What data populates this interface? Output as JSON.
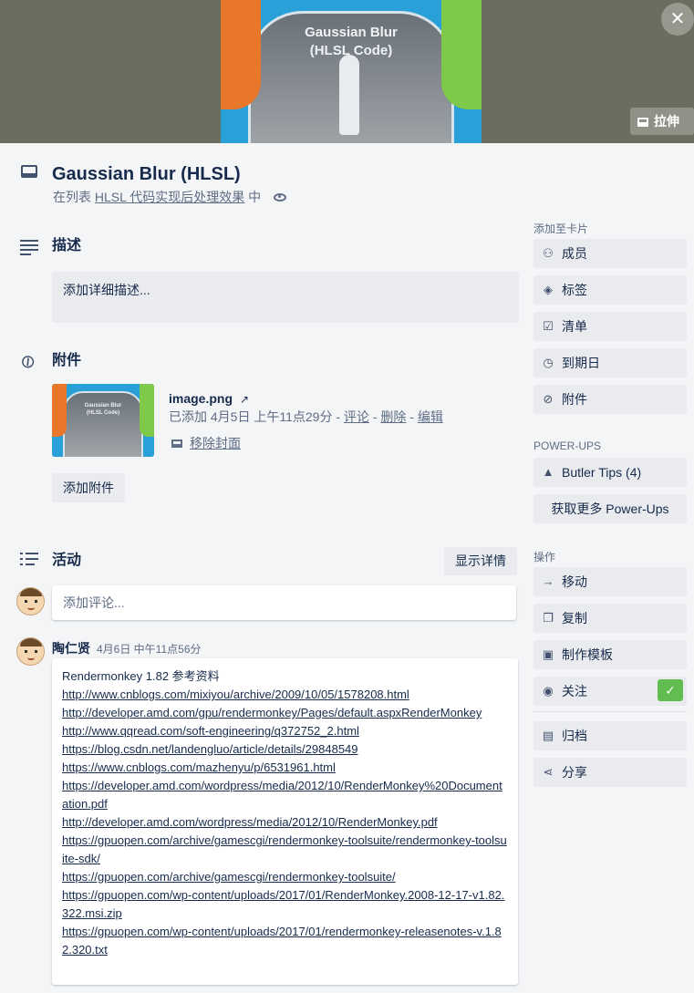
{
  "cover": {
    "image_text_line1": "Gaussian Blur",
    "image_text_line2": "(HLSL Code)",
    "stretch_label": "拉伸"
  },
  "card": {
    "title": "Gaussian Blur (HLSL)",
    "in_list_prefix": "在列表",
    "list_name": "HLSL 代码实现后处理效果",
    "in_list_suffix": "中"
  },
  "description": {
    "heading": "描述",
    "placeholder": "添加详细描述..."
  },
  "attachments": {
    "heading": "附件",
    "items": [
      {
        "name": "image.png",
        "added": "已添加 4月5日 上午11点29分",
        "comment": "评论",
        "delete": "删除",
        "edit": "编辑",
        "remove_cover": "移除封面",
        "sep": "-"
      }
    ],
    "add_label": "添加附件"
  },
  "activity": {
    "heading": "活动",
    "show_details": "显示详情",
    "comment_placeholder": "添加评论...",
    "comments": [
      {
        "author": "陶仁贤",
        "time": "4月6日 中午11点56分",
        "text": "Rendermonkey 1.82 参考资料",
        "links": [
          "http://www.cnblogs.com/mixiyou/archive/2009/10/05/1578208.html",
          "http://developer.amd.com/gpu/rendermonkey/Pages/default.aspxRenderMonkey",
          "http://www.qqread.com/soft-engineering/q372752_2.html",
          "https://blog.csdn.net/landengluo/article/details/29848549",
          "https://www.cnblogs.com/mazhenyu/p/6531961.html",
          "https://developer.amd.com/wordpress/media/2012/10/RenderMonkey%20Documentation.pdf",
          "http://developer.amd.com/wordpress/media/2012/10/RenderMonkey.pdf",
          "https://gpuopen.com/archive/gamescgi/rendermonkey-toolsuite/rendermonkey-toolsuite-sdk/",
          "https://gpuopen.com/archive/gamescgi/rendermonkey-toolsuite/",
          "https://gpuopen.com/wp-content/uploads/2017/01/RenderMonkey.2008-12-17-v1.82.322.msi.zip",
          "https://gpuopen.com/wp-content/uploads/2017/01/rendermonkey-releasenotes-v.1.82.320.txt"
        ]
      }
    ]
  },
  "sidebar": {
    "add_to_card_heading": "添加至卡片",
    "add_items": [
      "成员",
      "标签",
      "清单",
      "到期日",
      "附件"
    ],
    "powerups_heading": "POWER-UPS",
    "butler_tips": "Butler Tips (4)",
    "get_more_powerups": "获取更多 Power-Ups",
    "actions_heading": "操作",
    "action_items": [
      "移动",
      "复制",
      "制作模板",
      "关注"
    ],
    "archive": "归档",
    "share": "分享",
    "watch_checked": true
  },
  "colors": {
    "accent_green": "#61bd4f",
    "cover_bg": "#6b6e5f",
    "page_bg": "#f4f5f7"
  }
}
